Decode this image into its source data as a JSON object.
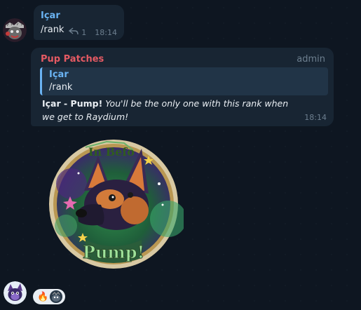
{
  "messages": [
    {
      "sender": "Içar",
      "text": "/rank",
      "reply_count": "1",
      "time": "18:14"
    },
    {
      "sender": "Pup Patches",
      "role": "admin",
      "quote": {
        "sender": "Içar",
        "text": "/rank"
      },
      "body": {
        "bold": "Içar - Pump!",
        "italic": "You'll be the only one with this rank when we get to Raydium!"
      },
      "time": "18:14"
    }
  ],
  "sticker": {
    "top_text": "In Befo",
    "bottom_text": "Pump!"
  },
  "reactions": {
    "emoji": "🔥",
    "icons": [
      "fire-icon",
      "reactor-avatar"
    ]
  },
  "icons": {
    "reply": "reply-arrow-icon"
  },
  "colors": {
    "background": "#0e1621",
    "bubble": "#182533",
    "name_blue": "#6ab3f3",
    "admin_red": "#e55a63",
    "meta_gray": "#6d7f8f"
  }
}
